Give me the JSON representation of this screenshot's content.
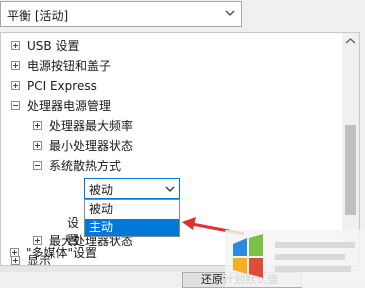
{
  "power_plan": {
    "selected": "平衡 [活动]"
  },
  "tree": {
    "items": [
      {
        "label": "USB 设置",
        "state": "plus"
      },
      {
        "label": "电源按钮和盖子",
        "state": "plus"
      },
      {
        "label": "PCI Express",
        "state": "plus"
      },
      {
        "label": "处理器电源管理",
        "state": "minus"
      },
      {
        "label": "处理器最大频率",
        "state": "plus"
      },
      {
        "label": "最小处理器状态",
        "state": "plus"
      },
      {
        "label": "系统散热方式",
        "state": "minus"
      },
      {
        "label": "最大处理器状态",
        "state": "plus"
      },
      {
        "label": "显示",
        "state": "plus"
      },
      {
        "label": "\"多媒体\"设置",
        "state": "plus"
      }
    ],
    "setting_label": "设置:",
    "setting_value": "被动",
    "options": [
      "被动",
      "主动"
    ],
    "highlighted_option": "主动"
  },
  "footer": {
    "button_label": "还原计划默认值"
  },
  "colors": {
    "accent": "#0078d7",
    "arrow": "#e03030"
  },
  "icons": [
    "chevron-down-icon",
    "plus-icon",
    "minus-icon",
    "scroll-up-arrow-icon",
    "red-arrow-icon",
    "watermark-logo-icon"
  ]
}
